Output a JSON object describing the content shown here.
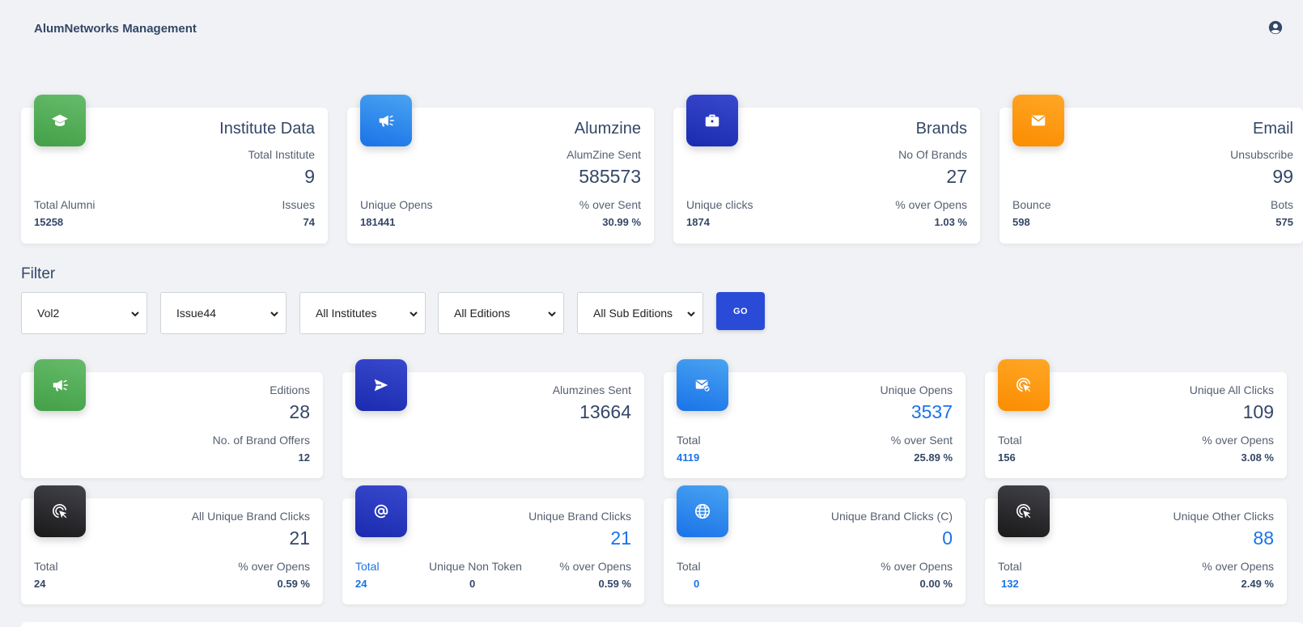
{
  "app": {
    "title": "AlumNetworks Management"
  },
  "header": {
    "user_icon": "user-circle-icon"
  },
  "top_cards": [
    {
      "icon": "graduation-cap-icon",
      "color": "#4caf50",
      "title": "Institute Data",
      "main_label": "Total Institute",
      "main_value": "9",
      "left_label": "Total Alumni",
      "left_value": "15258",
      "right_label": "Issues",
      "right_value": "74"
    },
    {
      "icon": "megaphone-icon",
      "color": "#1a73e8",
      "title": "Alumzine",
      "main_label": "AlumZine Sent",
      "main_value": "585573",
      "left_label": "Unique Opens",
      "left_value": "181441",
      "right_label": "% over Sent",
      "right_value": "30.99 %"
    },
    {
      "icon": "briefcase-icon",
      "color": "#1a2bb0",
      "title": "Brands",
      "main_label": "No Of Brands",
      "main_value": "27",
      "left_label": "Unique clicks",
      "left_value": "1874",
      "right_label": "% over Opens",
      "right_value": "1.03 %"
    },
    {
      "icon": "envelope-icon",
      "color": "#fb8c00",
      "title": "Email",
      "main_label": "Unsubscribe",
      "main_value": "99",
      "left_label": "Bounce",
      "left_value": "598",
      "right_label": "Bots",
      "right_value": "575"
    }
  ],
  "filter": {
    "title": "Filter",
    "selects": [
      "Vol2",
      "Issue44",
      "All Institutes",
      "All Editions",
      "All Sub Editions"
    ],
    "go_label": "GO"
  },
  "stat_cards_row1": [
    {
      "icon": "megaphone-icon",
      "color": "#4caf50",
      "main_label": "Editions",
      "main_value": "28",
      "sub_label": "No. of Brand Offers",
      "sub_value": "12"
    },
    {
      "icon": "paper-plane-icon",
      "color": "#1a2bb0",
      "main_label": "Alumzines Sent",
      "main_value": "13664"
    },
    {
      "icon": "envelope-check-icon",
      "color": "#1a73e8",
      "main_label": "Unique Opens",
      "main_value": "3537",
      "left_label": "Total",
      "left_value": "4119",
      "right_label": "% over Sent",
      "right_value": "25.89 %"
    },
    {
      "icon": "cursor-click-icon",
      "color": "#fb8c00",
      "main_label": "Unique All Clicks",
      "main_value": "109",
      "left_label": "Total",
      "left_value": "156",
      "right_label": "% over Opens",
      "right_value": "3.08 %"
    }
  ],
  "stat_cards_row2": [
    {
      "icon": "cursor-click-icon",
      "color": "#191919",
      "main_label": "All Unique Brand Clicks",
      "main_value": "21",
      "left_label": "Total",
      "left_value": "24",
      "right_label": "% over Opens",
      "right_value": "0.59 %"
    },
    {
      "icon": "at-sign-icon",
      "color": "#1a2bb0",
      "main_label": "Unique Brand Clicks",
      "main_value": "21",
      "left_label": "Total",
      "left_value": "24",
      "mid_label": "Unique Non Token",
      "mid_value": "0",
      "right_label": "% over Opens",
      "right_value": "0.59 %"
    },
    {
      "icon": "globe-icon",
      "color": "#1a73e8",
      "main_label": "Unique Brand Clicks (C)",
      "main_value": "0",
      "left_label": "Total",
      "left_value": "0",
      "right_label": "% over Opens",
      "right_value": "0.00 %"
    },
    {
      "icon": "cursor-click-icon",
      "color": "#191919",
      "main_label": "Unique Other Clicks",
      "main_value": "88",
      "left_label": "Total",
      "left_value": "132",
      "right_label": "% over Opens",
      "right_value": "2.49 %"
    }
  ]
}
